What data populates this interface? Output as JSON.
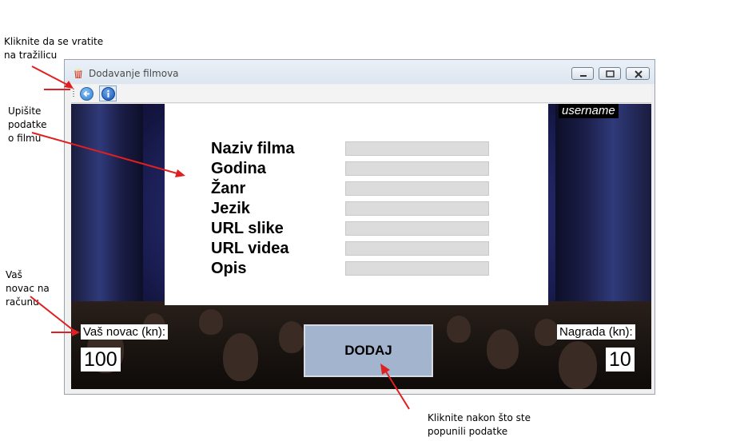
{
  "annotations": {
    "back_hint_line1": "Kliknite da se vratite",
    "back_hint_line2": "na tražilicu",
    "form_hint_line1": "Upišite",
    "form_hint_line2": "podatke",
    "form_hint_line3": "o filmu",
    "money_hint_line1": "Vaš",
    "money_hint_line2": "novac na",
    "money_hint_line3": "računu",
    "add_hint_line1": "Kliknite nakon što ste",
    "add_hint_line2": "popunili podatke"
  },
  "window": {
    "title": "Dodavanje filmova"
  },
  "toolbar": {
    "back_icon": "back-arrow-icon",
    "info_icon": "info-icon"
  },
  "user": {
    "username": "username"
  },
  "form": {
    "fields": [
      {
        "label": "Naziv filma",
        "value": ""
      },
      {
        "label": "Godina",
        "value": ""
      },
      {
        "label": "Žanr",
        "value": ""
      },
      {
        "label": "Jezik",
        "value": ""
      },
      {
        "label": "URL slike",
        "value": ""
      },
      {
        "label": "URL videa",
        "value": ""
      },
      {
        "label": "Opis",
        "value": ""
      }
    ]
  },
  "money": {
    "label": "Vaš novac (kn):",
    "value": "100"
  },
  "reward": {
    "label": "Nagrada (kn):",
    "value": "10"
  },
  "actions": {
    "add_label": "DODAJ"
  },
  "colors": {
    "annotation_arrow": "#e02020",
    "add_button": "#a3b4cf",
    "field_bg": "#dcdcdc"
  }
}
